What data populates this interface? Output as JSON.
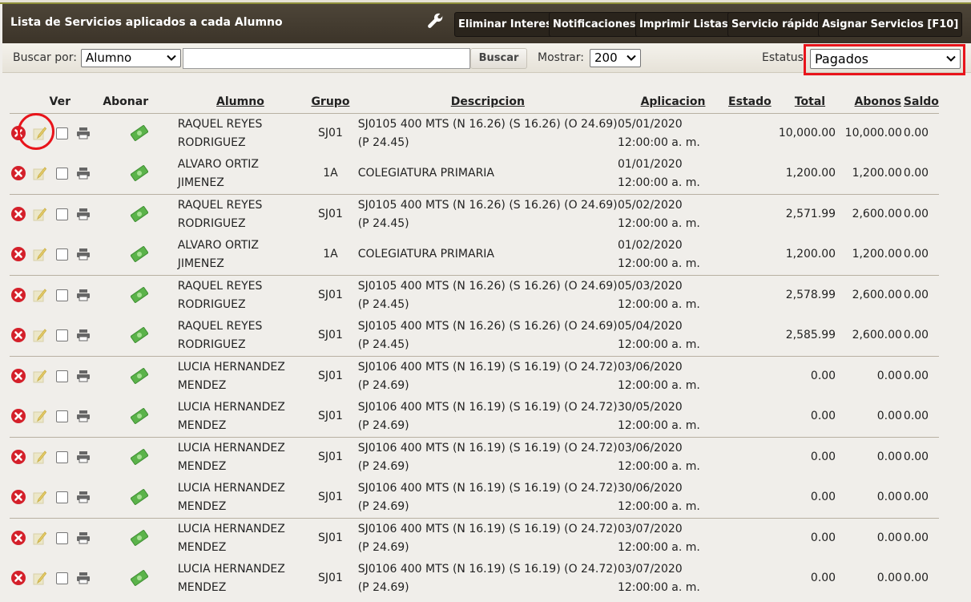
{
  "header": {
    "title": "Lista de Servicios aplicados a cada Alumno",
    "buttons": {
      "eliminar_interes": "Eliminar Interes",
      "notificaciones": "Notificaciones",
      "imprimir_listas": "Imprimir Listas",
      "servicio_rapido": "Servicio rápido",
      "asignar_servicios": "Asignar Servicios [F10]"
    }
  },
  "search": {
    "buscar_por_label": "Buscar por:",
    "buscar_por_value": "Alumno",
    "query_value": "",
    "buscar_button": "Buscar",
    "mostrar_label": "Mostrar:",
    "mostrar_value": "200",
    "estatus_label": "Estatus",
    "estatus_value": "Pagados"
  },
  "table": {
    "headers": {
      "ver": "Ver",
      "abonar": "Abonar",
      "alumno": "Alumno",
      "grupo": "Grupo",
      "descripcion": "Descripcion",
      "aplicacion": "Aplicacion",
      "estado": "Estado",
      "total": "Total",
      "abonos": "Abonos",
      "saldo": "Saldo"
    },
    "rows": [
      {
        "alumno": "RAQUEL REYES RODRIGUEZ",
        "grupo": "SJ01",
        "descripcion": "SJ0105 400 MTS (N 16.26) (S 16.26) (O 24.69) (P 24.45)",
        "aplicacion": "05/01/2020 12:00:00 a. m.",
        "estado": "",
        "total": "10,000.00",
        "abonos": "10,000.00",
        "saldo": "0.00"
      },
      {
        "alumno": "ALVARO ORTIZ JIMENEZ",
        "grupo": "1A",
        "descripcion": "COLEGIATURA PRIMARIA",
        "aplicacion": "01/01/2020 12:00:00 a. m.",
        "estado": "",
        "total": "1,200.00",
        "abonos": "1,200.00",
        "saldo": "0.00"
      },
      {
        "alumno": "RAQUEL REYES RODRIGUEZ",
        "grupo": "SJ01",
        "descripcion": "SJ0105 400 MTS (N 16.26) (S 16.26) (O 24.69) (P 24.45)",
        "aplicacion": "05/02/2020 12:00:00 a. m.",
        "estado": "",
        "total": "2,571.99",
        "abonos": "2,600.00",
        "saldo": "0.00"
      },
      {
        "alumno": "ALVARO ORTIZ JIMENEZ",
        "grupo": "1A",
        "descripcion": "COLEGIATURA PRIMARIA",
        "aplicacion": "01/02/2020 12:00:00 a. m.",
        "estado": "",
        "total": "1,200.00",
        "abonos": "1,200.00",
        "saldo": "0.00"
      },
      {
        "alumno": "RAQUEL REYES RODRIGUEZ",
        "grupo": "SJ01",
        "descripcion": "SJ0105 400 MTS (N 16.26) (S 16.26) (O 24.69) (P 24.45)",
        "aplicacion": "05/03/2020 12:00:00 a. m.",
        "estado": "",
        "total": "2,578.99",
        "abonos": "2,600.00",
        "saldo": "0.00"
      },
      {
        "alumno": "RAQUEL REYES RODRIGUEZ",
        "grupo": "SJ01",
        "descripcion": "SJ0105 400 MTS (N 16.26) (S 16.26) (O 24.69) (P 24.45)",
        "aplicacion": "05/04/2020 12:00:00 a. m.",
        "estado": "",
        "total": "2,585.99",
        "abonos": "2,600.00",
        "saldo": "0.00"
      },
      {
        "alumno": "LUCIA HERNANDEZ MENDEZ",
        "grupo": "SJ01",
        "descripcion": "SJ0106 400 MTS (N 16.19) (S 16.19) (O 24.72) (P 24.69)",
        "aplicacion": "03/06/2020 12:00:00 a. m.",
        "estado": "",
        "total": "0.00",
        "abonos": "0.00",
        "saldo": "0.00"
      },
      {
        "alumno": "LUCIA HERNANDEZ MENDEZ",
        "grupo": "SJ01",
        "descripcion": "SJ0106 400 MTS (N 16.19) (S 16.19) (O 24.72) (P 24.69)",
        "aplicacion": "30/05/2020 12:00:00 a. m.",
        "estado": "",
        "total": "0.00",
        "abonos": "0.00",
        "saldo": "0.00"
      },
      {
        "alumno": "LUCIA HERNANDEZ MENDEZ",
        "grupo": "SJ01",
        "descripcion": "SJ0106 400 MTS (N 16.19) (S 16.19) (O 24.72) (P 24.69)",
        "aplicacion": "03/06/2020 12:00:00 a. m.",
        "estado": "",
        "total": "0.00",
        "abonos": "0.00",
        "saldo": "0.00"
      },
      {
        "alumno": "LUCIA HERNANDEZ MENDEZ",
        "grupo": "SJ01",
        "descripcion": "SJ0106 400 MTS (N 16.19) (S 16.19) (O 24.72) (P 24.69)",
        "aplicacion": "30/06/2020 12:00:00 a. m.",
        "estado": "",
        "total": "0.00",
        "abonos": "0.00",
        "saldo": "0.00"
      },
      {
        "alumno": "LUCIA HERNANDEZ MENDEZ",
        "grupo": "SJ01",
        "descripcion": "SJ0106 400 MTS (N 16.19) (S 16.19) (O 24.72) (P 24.69)",
        "aplicacion": "03/07/2020 12:00:00 a. m.",
        "estado": "",
        "total": "0.00",
        "abonos": "0.00",
        "saldo": "0.00"
      },
      {
        "alumno": "LUCIA HERNANDEZ MENDEZ",
        "grupo": "SJ01",
        "descripcion": "SJ0106 400 MTS (N 16.19) (S 16.19) (O 24.72) (P 24.69)",
        "aplicacion": "03/07/2020 12:00:00 a. m.",
        "estado": "",
        "total": "0.00",
        "abonos": "0.00",
        "saldo": "0.00"
      }
    ]
  },
  "icons": {
    "delete": "delete-icon",
    "edit": "edit-icon",
    "print": "print-icon",
    "pay": "money-icon",
    "wrench": "wrench-icon"
  },
  "colors": {
    "header_bg": "#433a2e",
    "highlight": "#e8141b",
    "delete_red": "#d4202a",
    "money_green": "#5bb34a"
  }
}
